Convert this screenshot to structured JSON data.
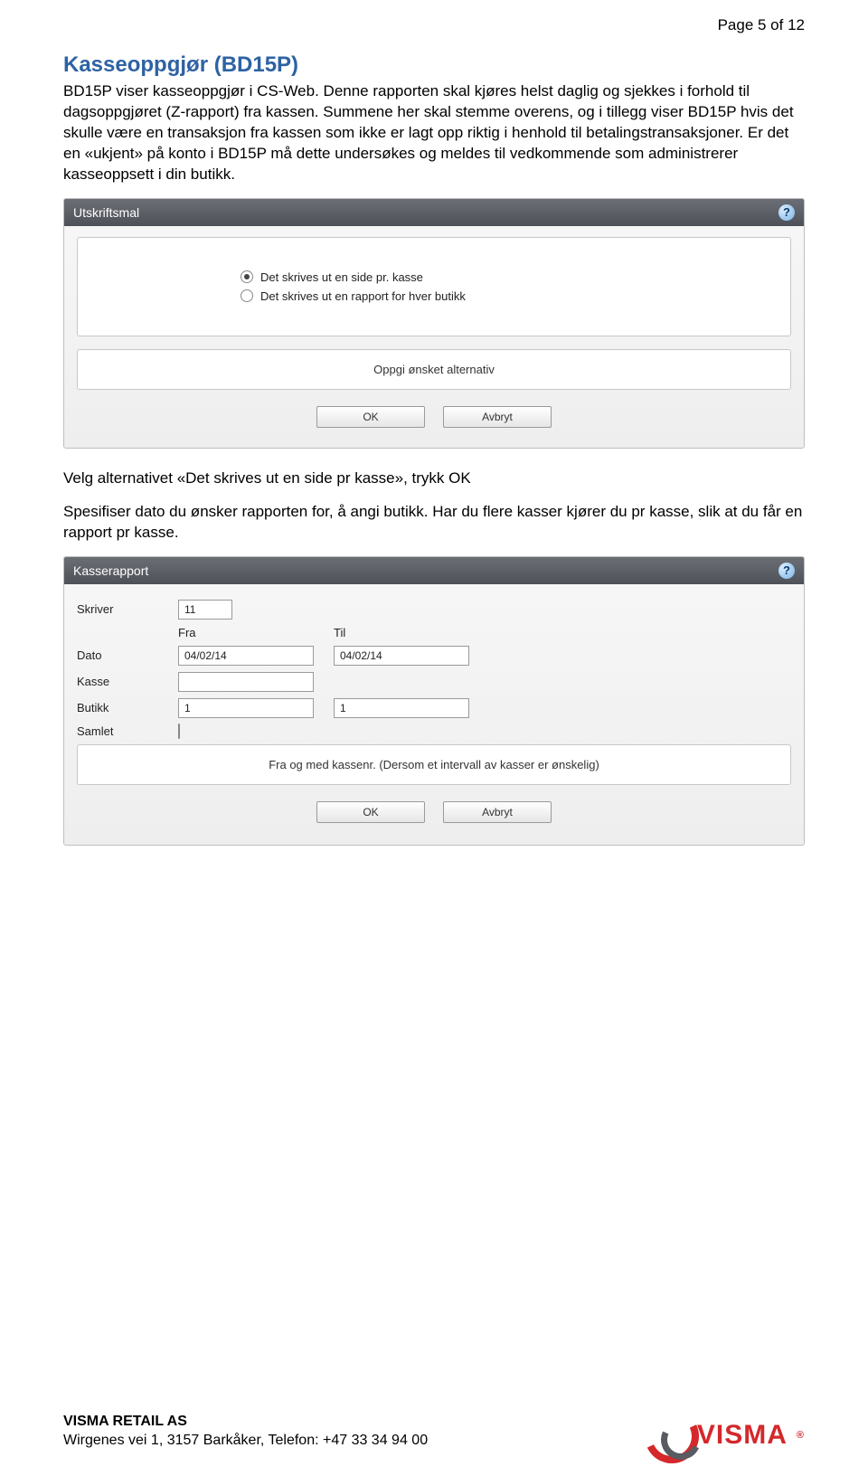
{
  "page_label": "Page 5 of 12",
  "title": "Kasseoppgjør (BD15P)",
  "intro": "BD15P viser kasseoppgjør i CS-Web. Denne rapporten skal kjøres helst daglig og sjekkes i forhold til dagsoppgjøret (Z-rapport) fra kassen. Summene her skal stemme overens, og i tillegg viser BD15P hvis det skulle være en transaksjon fra kassen som ikke er lagt opp riktig i henhold til betalingstransaksjoner. Er det en «ukjent» på konto i BD15P må dette undersøkes og meldes til vedkommende som administrerer kasseoppsett i din butikk.",
  "dialog1": {
    "title": "Utskriftsmal",
    "option1": "Det skrives ut en side pr. kasse",
    "option2": "Det skrives ut en rapport for hver butikk",
    "hint": "Oppgi ønsket alternativ",
    "ok": "OK",
    "cancel": "Avbryt"
  },
  "mid1": "Velg alternativet «Det skrives ut en side pr kasse», trykk OK",
  "mid2": "Spesifiser dato du ønsker rapporten for, å angi butikk. Har du flere kasser kjører du pr kasse, slik at du får en rapport pr kasse.",
  "dialog2": {
    "title": "Kasserapport",
    "labels": {
      "skriver": "Skriver",
      "fra": "Fra",
      "til": "Til",
      "dato": "Dato",
      "kasse": "Kasse",
      "butikk": "Butikk",
      "samlet": "Samlet"
    },
    "values": {
      "skriver": "11",
      "dato_fra": "04/02/14",
      "dato_til": "04/02/14",
      "kasse_fra": "",
      "butikk_fra": "1",
      "butikk_til": "1"
    },
    "hint": "Fra og med kassenr. (Dersom et intervall av kasser er ønskelig)",
    "ok": "OK",
    "cancel": "Avbryt"
  },
  "footer": {
    "company": "VISMA RETAIL AS",
    "address": "Wirgenes vei 1, 3157 Barkåker, Telefon: +47 33 34 94 00",
    "brand": "VISMA"
  }
}
